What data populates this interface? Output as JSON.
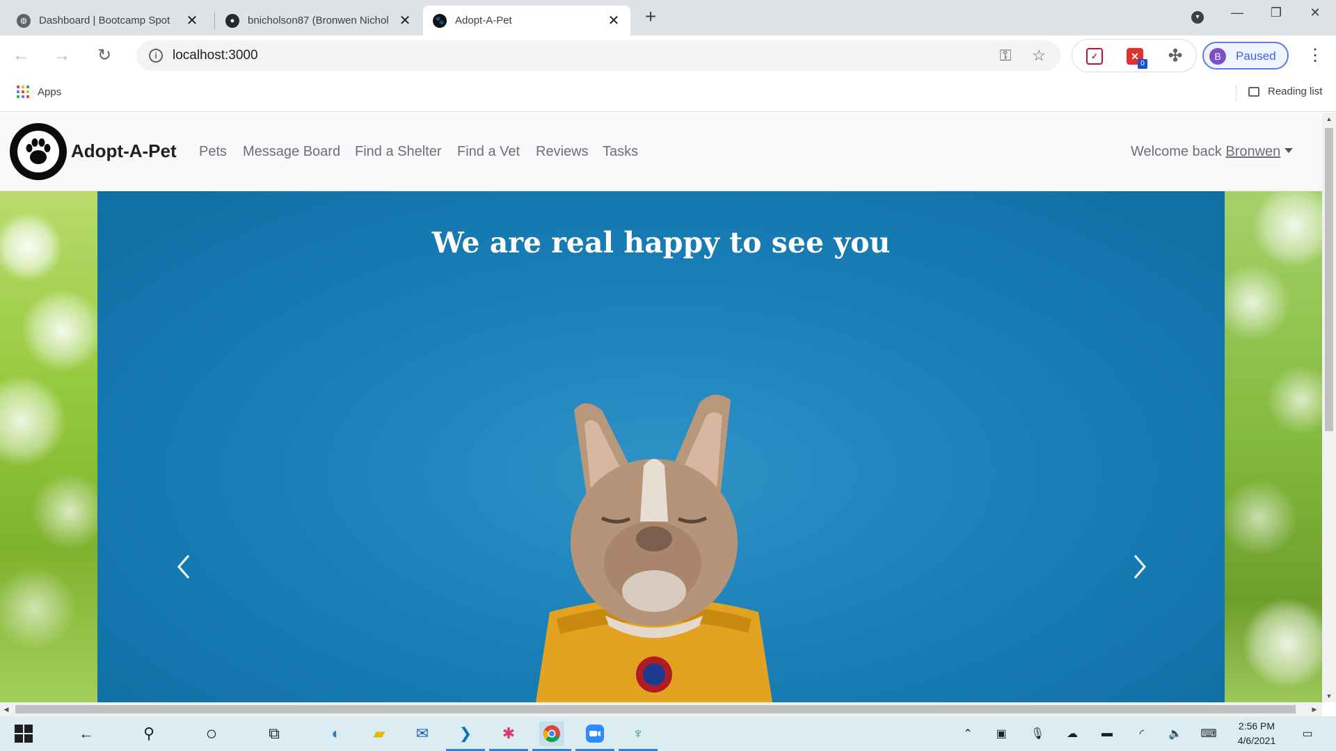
{
  "browser": {
    "tabs": [
      {
        "title": "Dashboard | Bootcamp Spot",
        "active": false,
        "favicon": "globe-icon"
      },
      {
        "title": "bnicholson87 (Bronwen Nichol",
        "active": false,
        "favicon": "github-icon"
      },
      {
        "title": "Adopt-A-Pet",
        "active": true,
        "favicon": "paw-icon"
      }
    ],
    "url": "localhost:3000",
    "profile": {
      "initial": "B",
      "status": "Paused"
    },
    "extension_badge": "0",
    "bookmarks": {
      "apps_label": "Apps",
      "reading_list_label": "Reading list"
    }
  },
  "site": {
    "brand": "Adopt-A-Pet",
    "nav": [
      "Pets",
      "Message Board",
      "Find a Shelter",
      "Find a Vet",
      "Reviews",
      "Tasks"
    ],
    "welcome_prefix": "Welcome back",
    "username": "Bronwen",
    "hero_title": "We are real happy to see you"
  },
  "taskbar": {
    "time": "2:56 PM",
    "date": "4/6/2021",
    "apps": [
      "edge-icon",
      "file-explorer-icon",
      "mail-icon",
      "vscode-icon",
      "slack-icon",
      "chrome-icon",
      "zoom-icon",
      "git-kraken-icon"
    ]
  },
  "colors": {
    "brand_accent": "#0b0b0b",
    "hero_bg": "#1a80b8",
    "profile_accent": "#4263d8",
    "taskbar_bg": "#dcecf3"
  }
}
